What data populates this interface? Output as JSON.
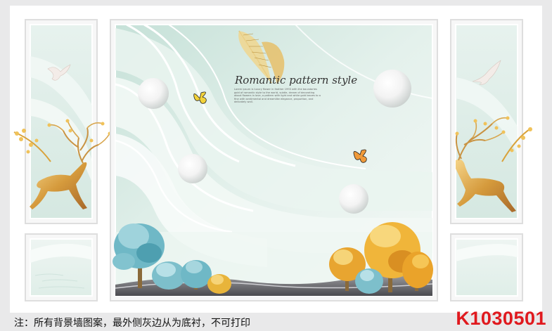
{
  "canvas": {
    "background": "#e9e9ea",
    "panel_white": "#ffffff",
    "mint": "#d5e8e1",
    "gold": "#d9a23a",
    "teal_tree": "#6fb8c6"
  },
  "artwork": {
    "heading": "Romantic pattern style",
    "description": "Lorem ipsum is luxury flower in feather 1993 with the boundaries gold of romantic style to the world, subtle, dream of decorating about flowers in love, a pattern with light and white gold leaves to a fine with sentimental and dreamlike elegance, proportion, and delicately wall."
  },
  "footer": {
    "note": "注：所有背景墙图案，最外侧灰边从为底衬，不可打印",
    "code": "K1030501",
    "code_color": "#e0191e"
  }
}
